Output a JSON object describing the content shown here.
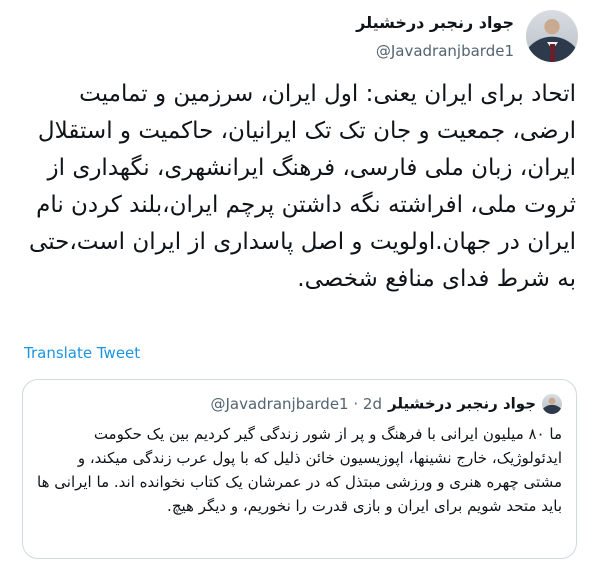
{
  "author": {
    "display_name": "جواد رنجبر درخشیلر",
    "handle": "@Javadranjbarde1",
    "avatar_icon": "profile-photo"
  },
  "tweet": {
    "text": "اتحاد برای ایران یعنی: اول ایران، سرزمین و تمامیت ارضی، جمعیت و جان تک تک ایرانیان، حاکمیت و استقلال ایران، زبان ملی فارسی، فرهنگ ایرانشهری، نگهداری از ثروت ملی، افراشته نگه داشتن پرچم ایران،بلند کردن نام ایران در جهان.اولویت و اصل پاسداری از ایران است،حتی به شرط فدای منافع شخصی.",
    "translate_label": "Translate Tweet"
  },
  "quoted_tweet": {
    "display_name": "جواد رنجبر درخشیلر",
    "meta": "@Javadranjbarde1 · 2d",
    "text": "ما ۸۰ میلیون ایرانی با فرهنگ و پر از شور زندگی گیر کردیم بین یک حکومت ایدئولوژیک، خارج نشینها، اپوزیسیون خائن ذلیل که با پول عرب زندگی میکند، و مشتی چهره هنری و ورزشی مبتذل که در عمرشان یک کتاب نخوانده اند. ما ایرانی ها باید متحد شویم برای ایران و بازی قدرت را نخوریم، و دیگر هیچ."
  },
  "colors": {
    "text": "#0f1419",
    "secondary": "#536471",
    "link": "#1b95e0",
    "border": "#cfd9de"
  }
}
